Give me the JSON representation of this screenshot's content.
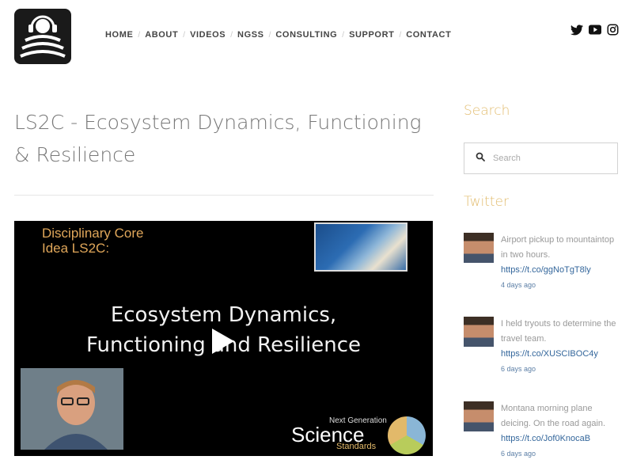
{
  "header": {
    "nav": [
      "HOME",
      "ABOUT",
      "VIDEOS",
      "NGSS",
      "CONSULTING",
      "SUPPORT",
      "CONTACT"
    ],
    "nav_separator": "/",
    "social": [
      "twitter-icon",
      "youtube-icon",
      "instagram-icon"
    ]
  },
  "post": {
    "title": "LS2C - Ecosystem Dynamics, Functioning & Resilience",
    "video": {
      "label_line1": "Disciplinary Core",
      "label_line2": "Idea LS2C:",
      "headline_line1": "Ecosystem Dynamics,",
      "headline_line2": "Functioning and Resilience",
      "ngss_top": "Next Generation",
      "ngss_main": "Science",
      "ngss_bottom": "Standards"
    }
  },
  "sidebar": {
    "search_heading": "Search",
    "search_placeholder": "Search",
    "twitter_heading": "Twitter",
    "tweets": [
      {
        "text": "Airport pickup to mountaintop in two hours.",
        "link": "https://t.co/ggNoTgT8ly",
        "time": "4 days ago"
      },
      {
        "text": "I held tryouts to determine the travel team.",
        "link": "https://t.co/XUSCIBOC4y",
        "time": "6 days ago"
      },
      {
        "text": "Montana morning plane deicing. On the road again.",
        "link": "https://t.co/Jof0KnocaB",
        "time": "6 days ago"
      }
    ]
  },
  "colors": {
    "accent": "#e2bc6e",
    "link": "#33669b",
    "text": "#777777"
  }
}
